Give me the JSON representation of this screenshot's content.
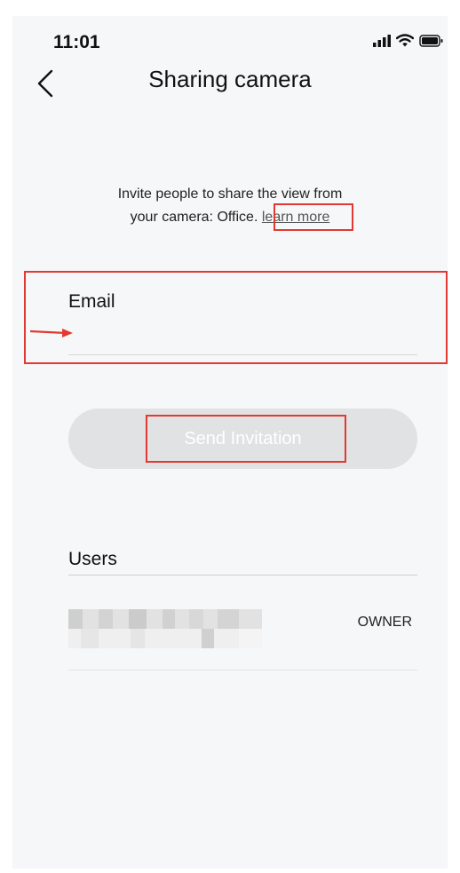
{
  "status_bar": {
    "time": "11:01",
    "icons": [
      "signal-icon",
      "wifi-icon",
      "battery-icon"
    ]
  },
  "header": {
    "title": "Sharing camera",
    "back_icon": "chevron-left-icon"
  },
  "intro": {
    "line1": "Invite people to share the view from",
    "line2": "your camera: Office.",
    "link": "learn more"
  },
  "email": {
    "label": "Email",
    "value": "",
    "placeholder": ""
  },
  "send_button": {
    "label": "Send Invitation"
  },
  "users": {
    "label": "Users",
    "rows": [
      {
        "name": "",
        "role": "OWNER"
      }
    ]
  },
  "colors": {
    "annotation": "#e23a32",
    "background": "#f6f7f9",
    "button_disabled": "#e1e2e4"
  }
}
